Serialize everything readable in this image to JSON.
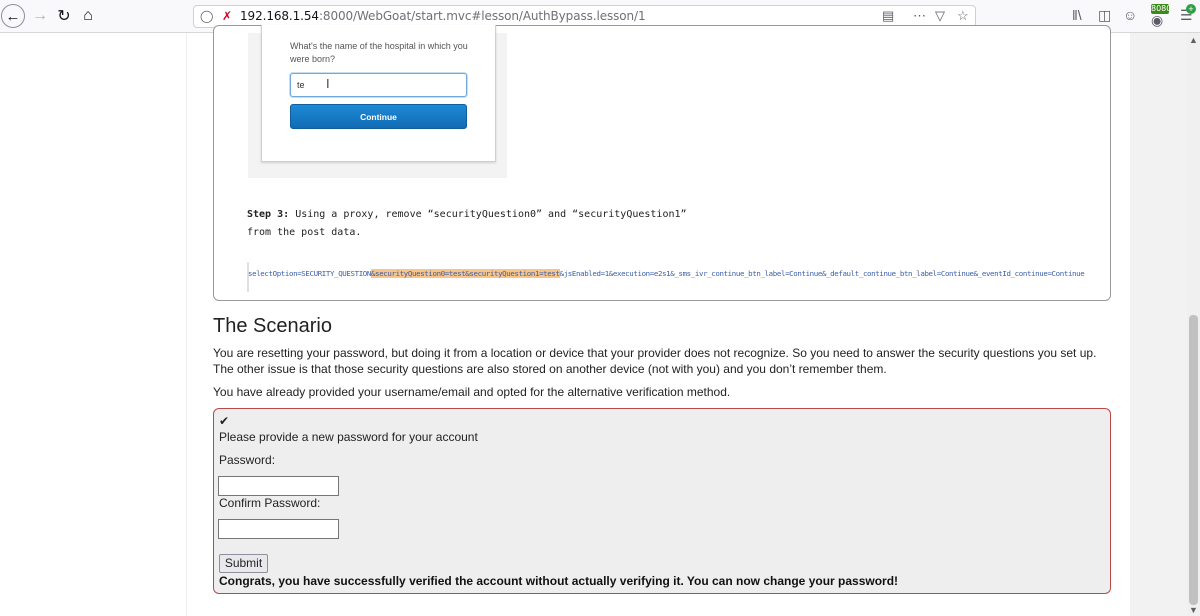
{
  "browser": {
    "url_host": "192.168.1.54",
    "url_path": ":8000/WebGoat/start.mvc#lesson/AuthBypass.lesson/1",
    "proxy_badge": "8080",
    "icons": {
      "back": "back-arrow-icon",
      "forward": "forward-arrow-icon",
      "reload": "reload-icon",
      "home": "home-icon",
      "tracking": "shield-icon",
      "insecure": "insecure-lock-icon",
      "reader": "reader-view-icon",
      "more": "more-icon",
      "pocket": "pocket-icon",
      "bookmark": "star-icon",
      "library": "library-icon",
      "sidebar": "sidebar-icon",
      "account": "account-icon",
      "menu": "hamburger-menu-icon"
    }
  },
  "lesson_image": {
    "question": "What's the name of the hospital in which you were born?",
    "answer_value": "te",
    "continue_label": "Continue"
  },
  "step3": {
    "label": "Step 3:",
    "text_line1": "Using a proxy, remove “securityQuestion0” and “securityQuestion1”",
    "text_line2": "from the post data."
  },
  "code": {
    "before": "selectOption=SECURITY_QUESTION",
    "highlight": "&securityQuestion0=test&securityQuestion1=test",
    "after": "&jsEnabled=1&execution=e2s1&_sms_ivr_continue_btn_label=Continue&_default_continue_btn_label=Continue&_eventId_continue=Continue"
  },
  "scenario": {
    "title": "The Scenario",
    "paragraph1": "You are resetting your password, but doing it from a location or device that your provider does not recognize. So you need to answer the security questions you set up. The other issue is that those security questions are also stored on another device (not with you) and you don’t remember them.",
    "paragraph2": "You have already provided your username/email and opted for the alternative verification method."
  },
  "form": {
    "check": "✔",
    "prompt": "Please provide a new password for your account",
    "password_label": "Password:",
    "confirm_label": "Confirm Password:",
    "submit_label": "Submit",
    "success_message": "Congrats, you have successfully verified the account without actually verifying it. You can now change your password!"
  }
}
